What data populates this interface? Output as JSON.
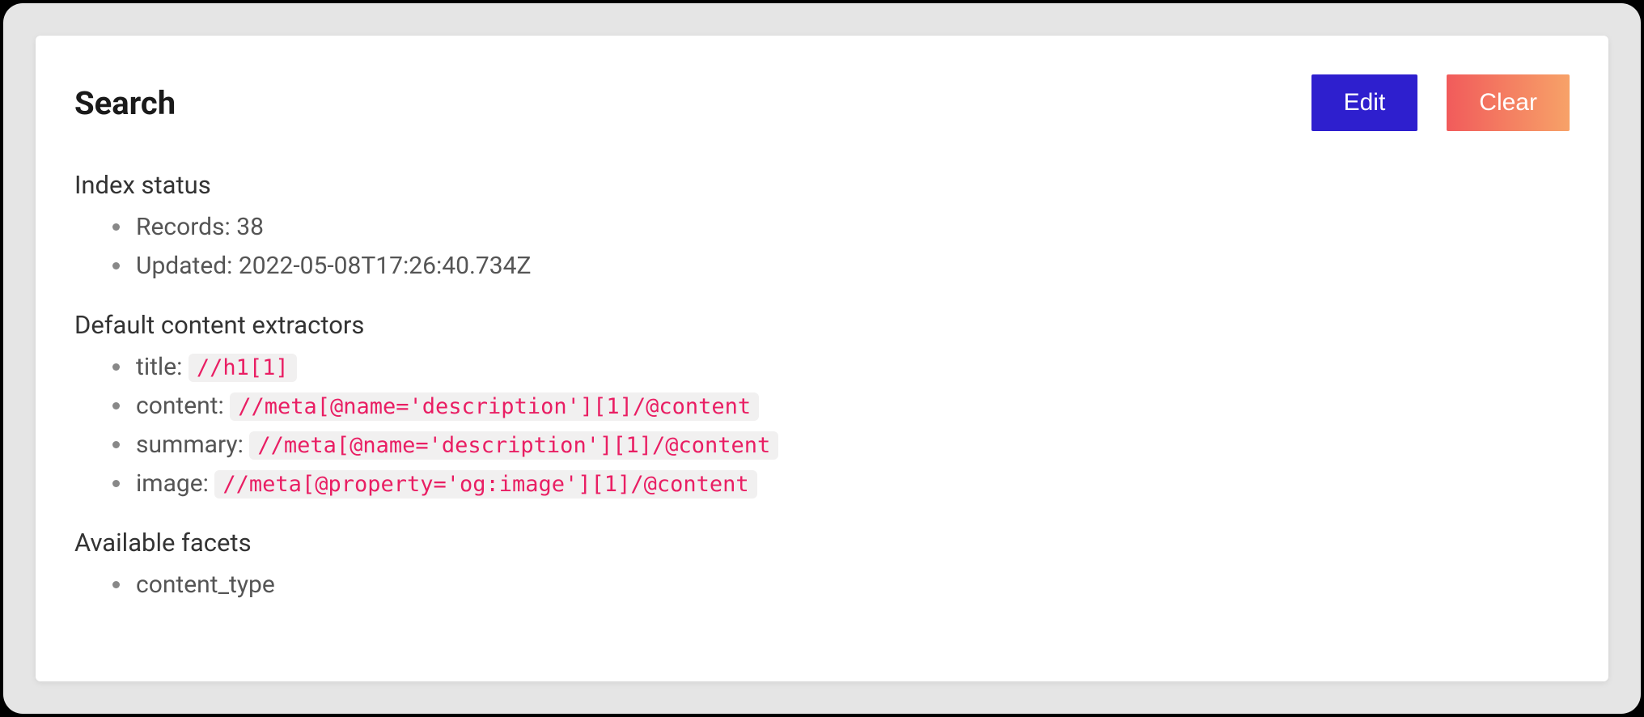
{
  "header": {
    "title": "Search",
    "edit_label": "Edit",
    "clear_label": "Clear"
  },
  "index_status": {
    "heading": "Index status",
    "records_label": "Records:",
    "records_value": "38",
    "updated_label": "Updated:",
    "updated_value": "2022-05-08T17:26:40.734Z"
  },
  "extractors": {
    "heading": "Default content extractors",
    "items": [
      {
        "label": "title:",
        "code": "//h1[1]"
      },
      {
        "label": "content:",
        "code": "//meta[@name='description'][1]/@content"
      },
      {
        "label": "summary:",
        "code": "//meta[@name='description'][1]/@content"
      },
      {
        "label": "image:",
        "code": "//meta[@property='og:image'][1]/@content"
      }
    ]
  },
  "facets": {
    "heading": "Available facets",
    "items": [
      "content_type"
    ]
  }
}
